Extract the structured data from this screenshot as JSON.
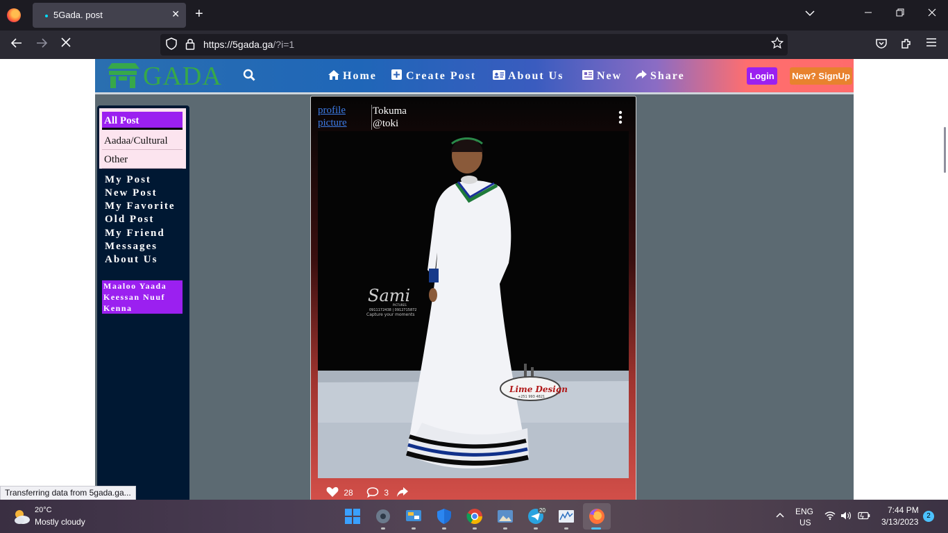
{
  "browser": {
    "tab_title": "5Gada. post",
    "url_host": "https://5gada.ga",
    "url_path": "/?i=1"
  },
  "site": {
    "logo_text": "GADA",
    "nav": [
      {
        "label": "Home",
        "icon": "home-icon"
      },
      {
        "label": "Create Post",
        "icon": "plus-square-icon"
      },
      {
        "label": "About Us",
        "icon": "id-card-icon"
      },
      {
        "label": "New",
        "icon": "newspaper-icon"
      },
      {
        "label": "Share",
        "icon": "share-icon"
      }
    ],
    "login_label": "Login",
    "signup_label": "New? SignUp",
    "colors": {
      "accent_purple": "#9b20f0",
      "signup_orange": "#e8822e",
      "logo_green": "#37a84a",
      "sidebar_bg": "#001833",
      "page_bg": "#5c6a72"
    }
  },
  "sidebar": {
    "categories": [
      "All Post",
      "Aadaa/Cultural",
      "Other"
    ],
    "links": [
      "My Post",
      "New Post",
      "My Favorite",
      "Old Post",
      "My Friend",
      "Messages",
      "About Us"
    ],
    "promo_lines": [
      "Maaloo Yaada",
      "Keessan Nuuf",
      "Kenna"
    ]
  },
  "post": {
    "profile_picture_alt_line1": "profile",
    "profile_picture_alt_line2": "picture",
    "author_name": "Tokuma",
    "author_handle": "@toki",
    "likes": "28",
    "comments": "3",
    "watermark_sami": "Sami",
    "watermark_sami_sub": "PICTURES",
    "watermark_sami_phone": "0911172438 | 0912715872",
    "watermark_sami_tag": "Capture your moments",
    "watermark_lime": "Lime Design",
    "watermark_lime_phone": "+251 993 4821"
  },
  "status_text": "Transferring data from 5gada.ga...",
  "taskbar": {
    "temperature": "20°C",
    "weather": "Mostly cloudy",
    "language": "ENG",
    "region": "US",
    "time": "7:44 PM",
    "date": "3/13/2023",
    "notifications": "2",
    "telegram_badge": "20"
  }
}
